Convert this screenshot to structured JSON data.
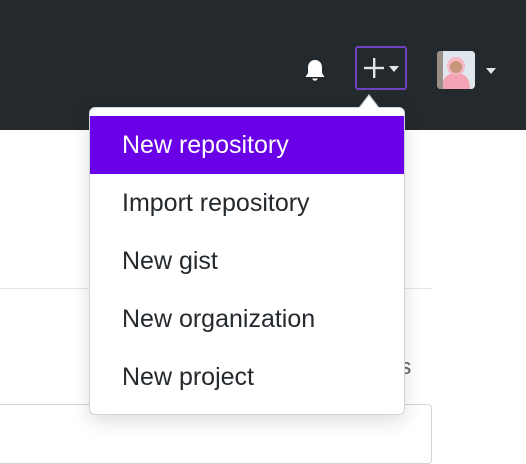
{
  "colors": {
    "header_bg": "#24292e",
    "accent": "#6a00e8",
    "button_border": "#6f42c1",
    "text": "#24292e"
  },
  "header": {
    "icons": [
      "bell-icon",
      "plus-icon",
      "chevron-down-icon",
      "avatar"
    ]
  },
  "create_menu": {
    "items": [
      {
        "label": "New repository",
        "active": true
      },
      {
        "label": "Import repository"
      },
      {
        "label": "New gist"
      },
      {
        "label": "New organization"
      },
      {
        "label": "New project"
      }
    ]
  },
  "background": {
    "partial_text": "ns"
  }
}
